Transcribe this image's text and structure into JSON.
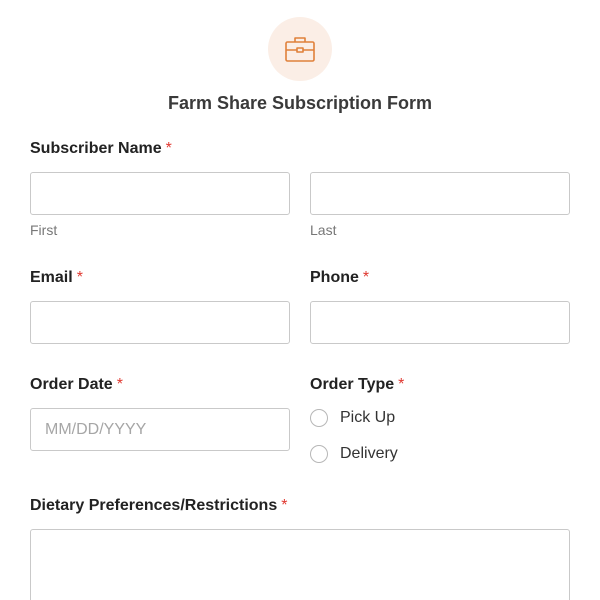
{
  "header": {
    "icon": "briefcase-icon",
    "icon_color": "#e0803a",
    "icon_bg": "#fbeee6",
    "title": "Farm Share Subscription Form"
  },
  "required_marker": "*",
  "fields": {
    "subscriber_name": {
      "label": "Subscriber Name",
      "first_sublabel": "First",
      "last_sublabel": "Last",
      "first_value": "",
      "last_value": ""
    },
    "email": {
      "label": "Email",
      "value": ""
    },
    "phone": {
      "label": "Phone",
      "value": ""
    },
    "order_date": {
      "label": "Order Date",
      "placeholder": "MM/DD/YYYY",
      "value": ""
    },
    "order_type": {
      "label": "Order Type",
      "options": [
        "Pick Up",
        "Delivery"
      ],
      "selected": null
    },
    "dietary": {
      "label": "Dietary Preferences/Restrictions",
      "value": ""
    }
  }
}
